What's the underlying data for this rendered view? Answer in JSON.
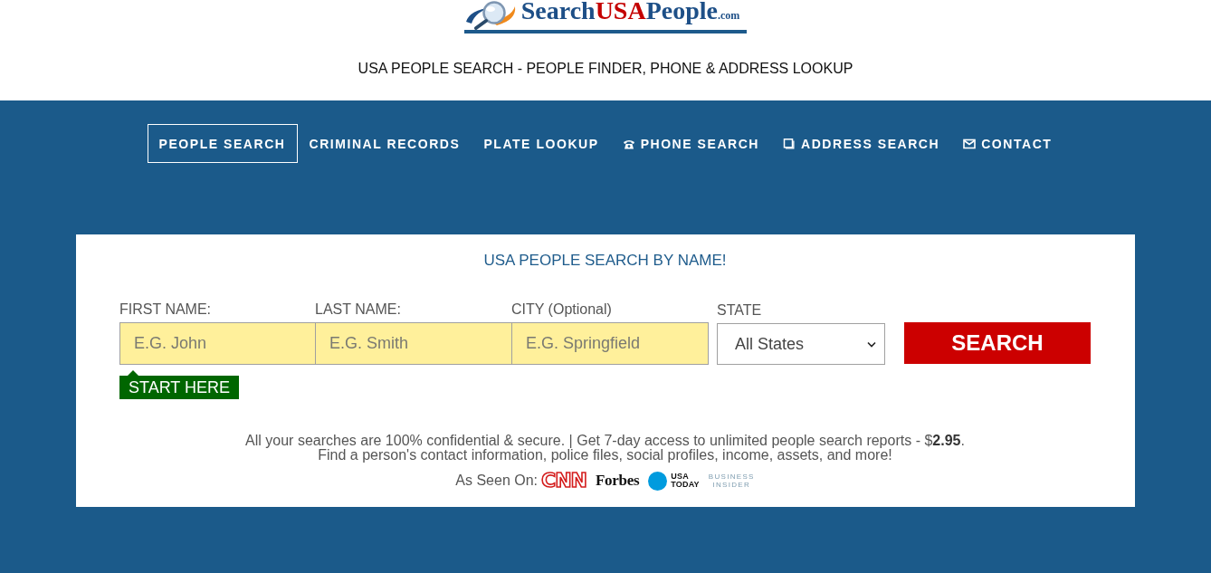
{
  "header": {
    "logo": {
      "parts": [
        {
          "text": "Search",
          "kind": "word"
        },
        {
          "text": "USA",
          "kind": "highlight"
        },
        {
          "text": "People",
          "kind": "word"
        },
        {
          "text": ".com",
          "kind": "suffix"
        }
      ]
    },
    "tagline": "USA PEOPLE SEARCH - PEOPLE FINDER, PHONE & ADDRESS LOOKUP"
  },
  "nav": [
    {
      "label": "PEOPLE SEARCH",
      "kind": "plain",
      "selected": true
    },
    {
      "label": "CRIMINAL RECORDS",
      "kind": "plain",
      "selected": false
    },
    {
      "label": "PLATE LOOKUP",
      "kind": "plain",
      "selected": false
    },
    {
      "label": "PHONE SEARCH",
      "kind": "phone",
      "selected": false
    },
    {
      "label": "ADDRESS SEARCH",
      "kind": "address",
      "selected": false
    },
    {
      "label": "CONTACT",
      "kind": "contact",
      "selected": false
    }
  ],
  "search_card": {
    "title": "USA PEOPLE SEARCH BY NAME!",
    "fields": [
      {
        "kind": "text",
        "label": "FIRST NAME:",
        "placeholder": "E.G. John"
      },
      {
        "kind": "text",
        "label": "LAST NAME:",
        "placeholder": "E.G. Smith"
      },
      {
        "kind": "text",
        "label": "CITY (Optional)",
        "placeholder": "E.G. Springfield"
      },
      {
        "kind": "select",
        "label": "STATE",
        "value": "All States"
      }
    ],
    "button": "SEARCH",
    "hint": "START HERE",
    "notes": [
      "All your searches are 100% confidential & secure. | Get 7-day access to unlimited people search reports - $**2.95**.",
      "Find a person's contact information, police files, social profiles, income, assets, and more!"
    ],
    "as_seen_on": {
      "label": "As Seen On:",
      "outlets": [
        {
          "kind": "outline",
          "text": "CNN"
        },
        {
          "kind": "serif",
          "text": "Forbes"
        },
        {
          "kind": "dot",
          "text": "USA TODAY"
        },
        {
          "kind": "spaced",
          "text": "BUSINESS INSIDER"
        }
      ]
    }
  }
}
